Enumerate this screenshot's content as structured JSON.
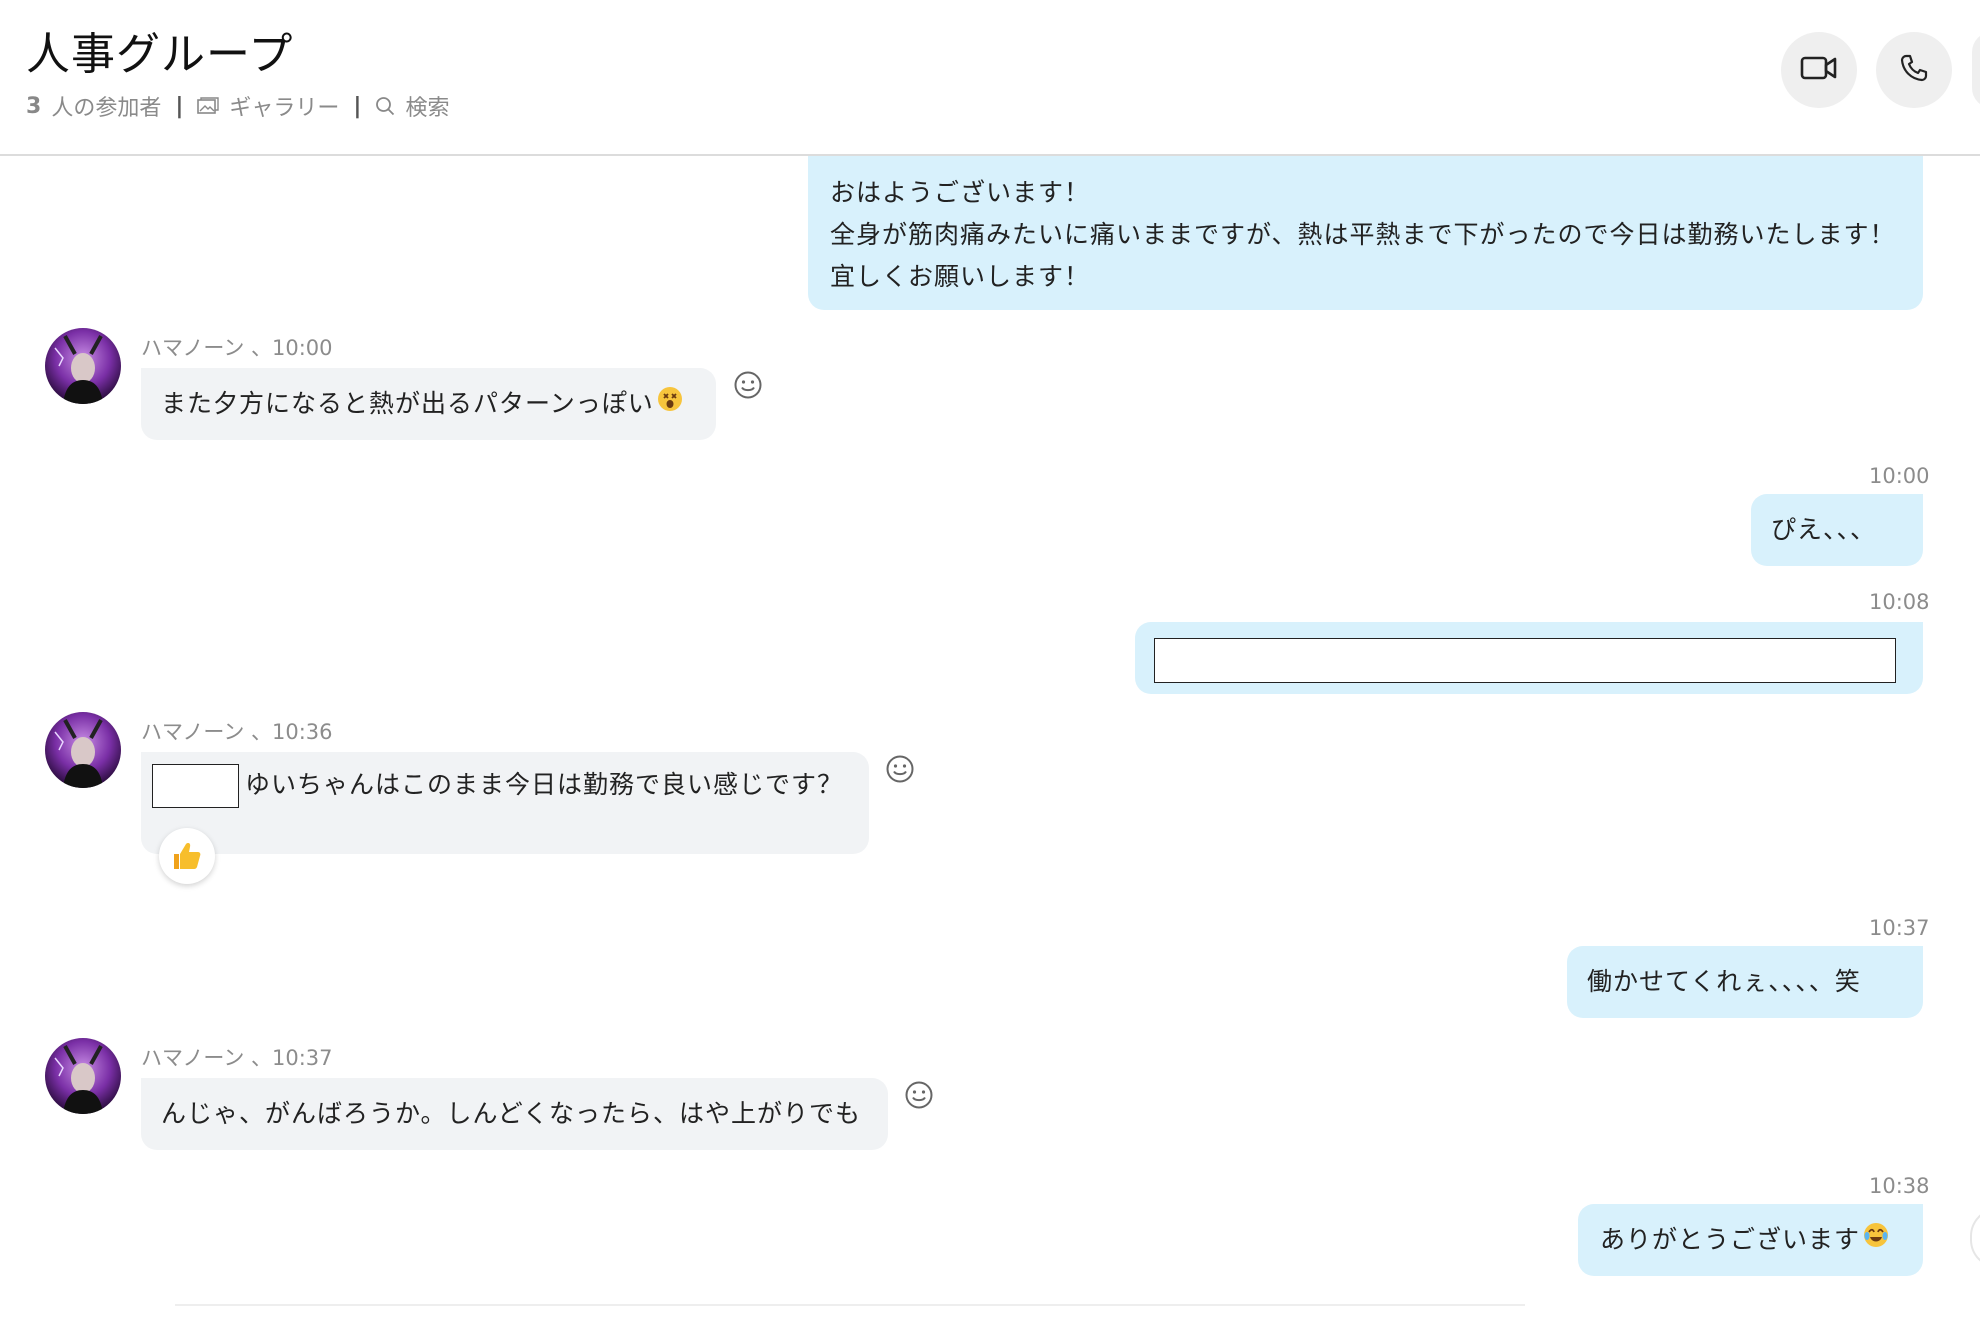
{
  "header": {
    "title": "人事グループ",
    "participants_count": "3",
    "participants_label": "人の参加者",
    "separator": "|",
    "gallery_label": "ギャラリー",
    "search_label": "検索",
    "icons": [
      "gallery-icon",
      "search-icon",
      "video-call-icon",
      "phone-icon"
    ]
  },
  "messages": [
    {
      "direction": "out",
      "lines": [
        "おはようございます！",
        "全身が筋肉痛みたいに痛いままですが、熱は平熱まで下がったので今日は勤務いたします！",
        "宜しくお願いします！"
      ]
    },
    {
      "direction": "in",
      "sender": "ハマノーン 、10:00",
      "text": "また夕方になると熱が出るパターンっぽい",
      "emoji": "dizzy-face"
    },
    {
      "direction": "out",
      "time": "10:00",
      "text": "ぴえ、、、"
    },
    {
      "direction": "out",
      "time": "10:08",
      "text": "",
      "redacted": true
    },
    {
      "direction": "in",
      "sender": "ハマノーン 、10:36",
      "text": "ゆいちゃんはこのまま今日は勤務で良い感じです？",
      "redacted_prefix": true,
      "reaction": "thumbs-up"
    },
    {
      "direction": "out",
      "time": "10:37",
      "text": "働かせてくれぇ、、、、笑"
    },
    {
      "direction": "in",
      "sender": "ハマノーン 、10:37",
      "text": "んじゃ、がんばろうか。しんどくなったら、はや上がりでも"
    },
    {
      "direction": "out",
      "time": "10:38",
      "text": "ありがとうございます",
      "emoji": "tears-of-joy"
    }
  ],
  "colors": {
    "outgoing_bubble": "#d8f1fc",
    "incoming_bubble": "#f1f3f5",
    "meta_text": "#8c8c8c",
    "call_button": "#efefef"
  }
}
